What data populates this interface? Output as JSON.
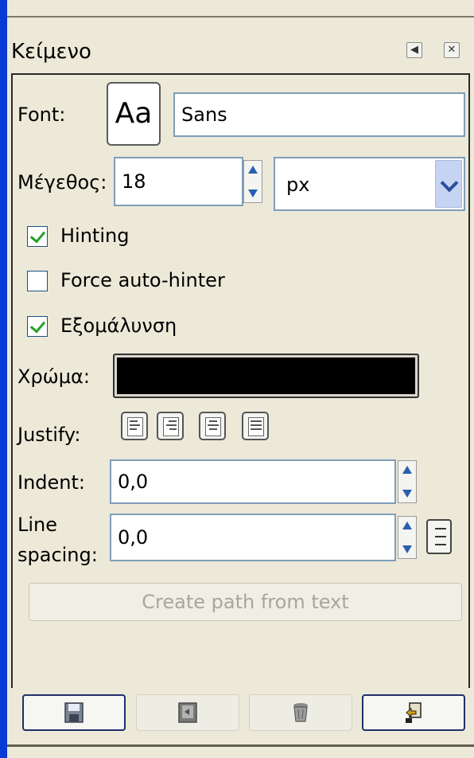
{
  "panel": {
    "title": "Κείμενο",
    "font_label": "Font:",
    "font_preview": "Aa",
    "font_value": "Sans",
    "size_label": "Μέγεθος:",
    "size_value": "18",
    "unit_value": "px",
    "hinting_label": "Hinting",
    "hinting_checked": true,
    "force_label": "Force auto-hinter",
    "force_checked": false,
    "antialias_label": "Εξομάλυνση",
    "antialias_checked": true,
    "color_label": "Χρώμα:",
    "color_value": "#000000",
    "justify_label": "Justify:",
    "justify_options": [
      "left",
      "right",
      "center",
      "fill"
    ],
    "indent_label": "Indent:",
    "indent_value": "0,0",
    "line_spacing_label_1": "Line",
    "line_spacing_label_2": "spacing:",
    "line_spacing_value": "0,0",
    "create_path_label": "Create path from text"
  },
  "icons": {
    "header": [
      "tab-menu-icon",
      "close-icon"
    ],
    "bottom": [
      "save-icon",
      "restore-icon",
      "delete-icon",
      "reset-icon"
    ]
  },
  "colors": {
    "desktop": "#0a3ad6",
    "panel_bg": "#ece9d8",
    "check_mark": "#21a121"
  }
}
